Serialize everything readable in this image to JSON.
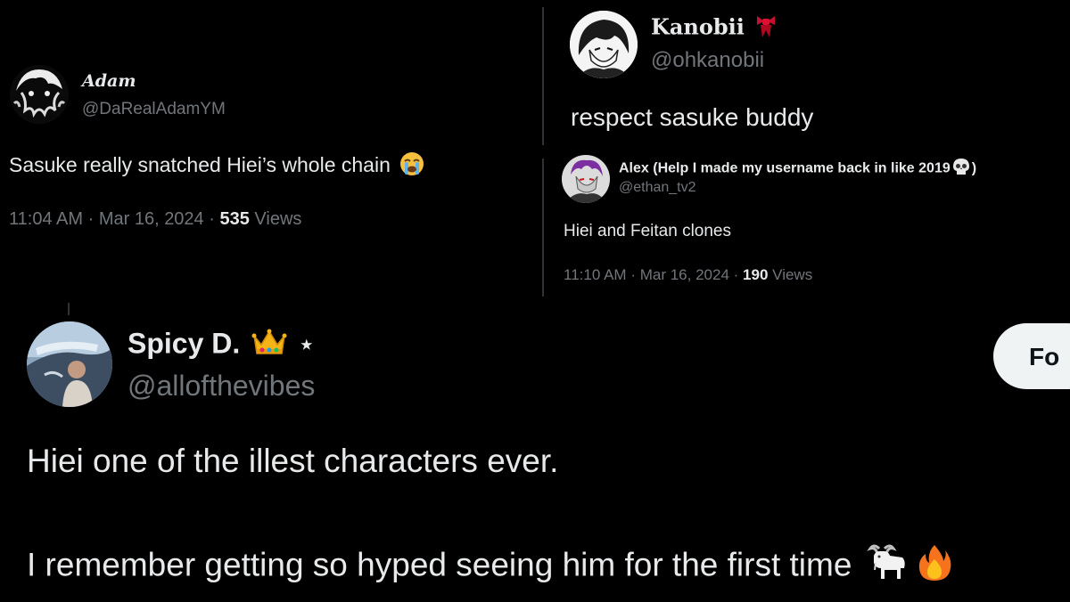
{
  "tweet_adam": {
    "display_name": "Adam",
    "handle": "@DaRealAdamYM",
    "text": "Sasuke really snatched Hiei’s whole chain",
    "time": "11:04 AM",
    "sep1": "·",
    "date": "Mar 16, 2024",
    "sep2": "·",
    "views_count": "535",
    "views_label": "Views",
    "emoji": "crying-face"
  },
  "tweet_kanobii": {
    "display_name": "Kanobii",
    "handle": "@ohkanobii",
    "text": "respect sasuke buddy",
    "badge": "red-ribbon-icon"
  },
  "tweet_alex": {
    "display_name": "Alex (Help I made my username back in like 2019",
    "display_name_end": ")",
    "handle": "@ethan_tv2",
    "text": "Hiei and Feitan clones",
    "time": "11:10 AM",
    "sep1": "·",
    "date": "Mar 16, 2024",
    "sep2": "·",
    "views_count": "190",
    "views_label": "Views",
    "emoji": "skull"
  },
  "tweet_spicy": {
    "display_name": "Spicy D.",
    "star": "⋆",
    "handle": "@allofthevibes",
    "line1": "Hiei one of the illest characters ever.",
    "line2": "I remember getting so hyped seeing him for the first time",
    "follow_label": "Fo",
    "emojis": [
      "crown",
      "goat",
      "fire"
    ]
  },
  "colors": {
    "background": "#000000",
    "text": "#e7e9ea",
    "secondary": "#71767b",
    "button_bg": "#eff3f4"
  }
}
